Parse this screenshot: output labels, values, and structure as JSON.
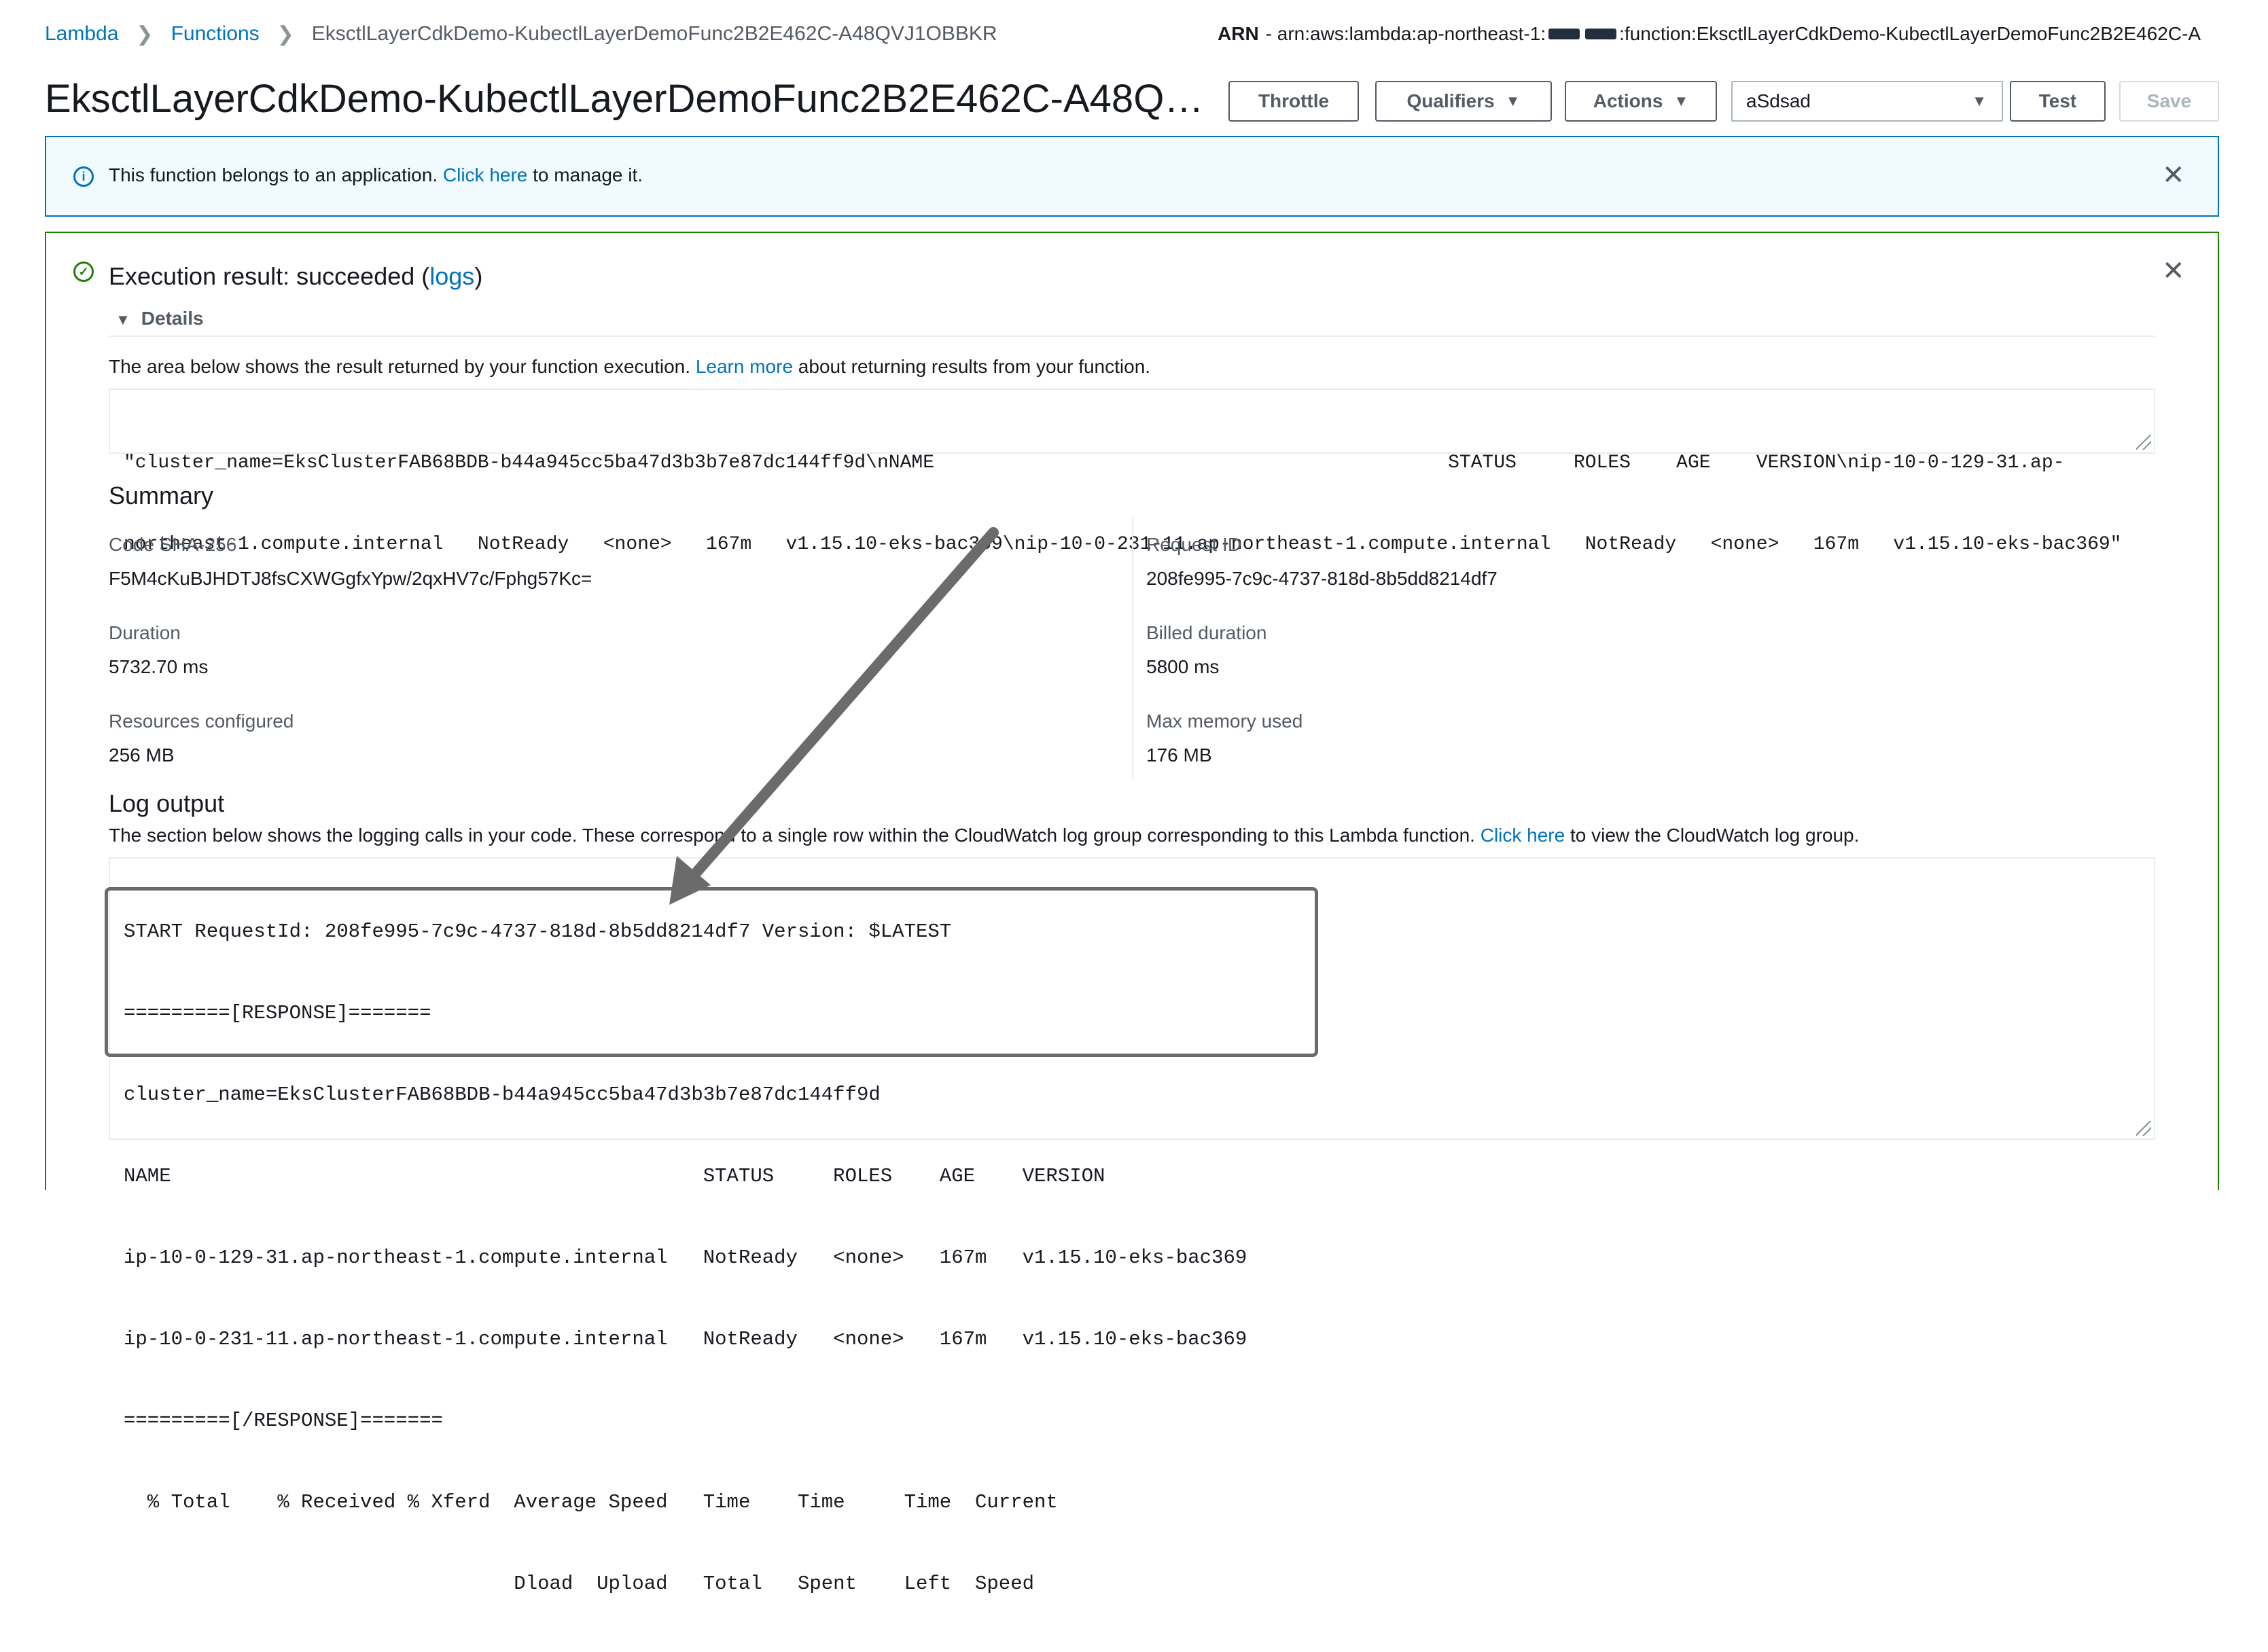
{
  "breadcrumb": {
    "items": [
      "Lambda",
      "Functions"
    ],
    "current": "EksctlLayerCdkDemo-KubectlLayerDemoFunc2B2E462C-A48QVJ1OBBKR"
  },
  "arn": {
    "label": "ARN",
    "prefix": "- arn:aws:lambda:ap-northeast-1:",
    "suffix": ":function:EksctlLayerCdkDemo-KubectlLayerDemoFunc2B2E462C-A"
  },
  "header": {
    "title": "EksctlLayerCdkDemo-KubectlLayerDemoFunc2B2E462C-A48QVJ1…",
    "buttons": {
      "throttle": "Throttle",
      "qualifiers": "Qualifiers",
      "actions": "Actions",
      "test": "Test",
      "save": "Save"
    },
    "test_event_select": "aSdsad"
  },
  "info_banner": {
    "text_before": "This function belongs to an application.",
    "link": "Click here",
    "text_after": "to manage it."
  },
  "result": {
    "title_prefix": "Execution result: succeeded (",
    "logs_link": "logs",
    "title_suffix": ")",
    "details_label": "Details",
    "intro_before": "The area below shows the result returned by your function execution.",
    "intro_link": "Learn more",
    "intro_after": "about returning results from your function.",
    "output_lines": [
      "\"cluster_name=EksClusterFAB68BDB-b44a945cc5ba47d3b3b7e87dc144ff9d\\nNAME                                             STATUS     ROLES    AGE    VERSION\\nip-10-0-129-31.ap-",
      "northeast-1.compute.internal   NotReady   <none>   167m   v1.15.10-eks-bac369\\nip-10-0-231-11.ap-northeast-1.compute.internal   NotReady   <none>   167m   v1.15.10-eks-bac369\""
    ]
  },
  "summary": {
    "heading": "Summary",
    "code_sha_label": "Code SHA-256",
    "code_sha_value": "F5M4cKuBJHDTJ8fsCXWGgfxYpw/2qxHV7c/Fphg57Kc=",
    "request_id_label": "Request ID",
    "request_id_value": "208fe995-7c9c-4737-818d-8b5dd8214df7",
    "duration_label": "Duration",
    "duration_value": "5732.70 ms",
    "billed_label": "Billed duration",
    "billed_value": "5800 ms",
    "resources_label": "Resources configured",
    "resources_value": "256 MB",
    "max_mem_label": "Max memory used",
    "max_mem_value": "176 MB"
  },
  "log_output": {
    "heading": "Log output",
    "intro_before": "The section below shows the logging calls in your code. These correspond to a single row within the CloudWatch log group corresponding to this Lambda function.",
    "intro_link": "Click here",
    "intro_after": "to view the CloudWatch log group.",
    "lines": [
      "START RequestId: 208fe995-7c9c-4737-818d-8b5dd8214df7 Version: $LATEST",
      "=========[RESPONSE]=======",
      "cluster_name=EksClusterFAB68BDB-b44a945cc5ba47d3b3b7e87dc144ff9d",
      "NAME                                             STATUS     ROLES    AGE    VERSION",
      "ip-10-0-129-31.ap-northeast-1.compute.internal   NotReady   <none>   167m   v1.15.10-eks-bac369",
      "ip-10-0-231-11.ap-northeast-1.compute.internal   NotReady   <none>   167m   v1.15.10-eks-bac369",
      "=========[/RESPONSE]=======",
      "  % Total    % Received % Xferd  Average Speed   Time    Time     Time  Current",
      "                                 Dload  Upload   Total   Spent    Left  Speed"
    ]
  },
  "colors": {
    "link": "#0073bb",
    "success": "#1d8102",
    "info_bg": "#f1faff",
    "annotation": "#6b6b6b"
  }
}
